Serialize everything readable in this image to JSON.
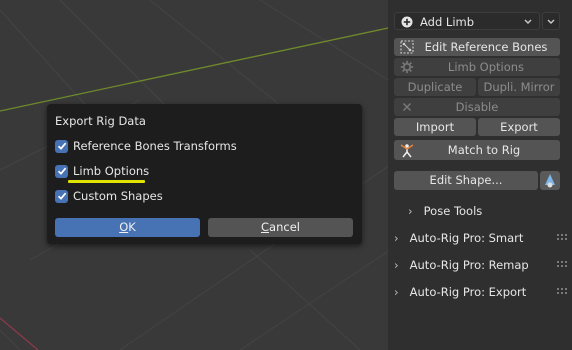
{
  "panel": {
    "add_limb": {
      "label": "Add Limb"
    },
    "edit_reference_bones": "Edit Reference Bones",
    "limb_options": "Limb Options",
    "duplicate": "Duplicate",
    "dupli_mirror": "Dupli. Mirror",
    "disable": "Disable",
    "import": "Import",
    "export": "Export",
    "match_to_rig": "Match to Rig",
    "edit_shape": "Edit Shape...",
    "sections": [
      {
        "label": "Pose Tools"
      },
      {
        "label": "Auto-Rig Pro: Smart"
      },
      {
        "label": "Auto-Rig Pro: Remap"
      },
      {
        "label": "Auto-Rig Pro: Export"
      }
    ]
  },
  "dialog": {
    "title": "Export Rig Data",
    "options": [
      {
        "label": "Reference Bones Transforms",
        "checked": true
      },
      {
        "label": "Limb Options",
        "checked": true
      },
      {
        "label": "Custom Shapes",
        "checked": true
      }
    ],
    "ok": {
      "mnemonic": "O",
      "rest": "K"
    },
    "cancel": {
      "mnemonic": "C",
      "rest": "ancel"
    }
  },
  "colors": {
    "accent": "#4772b3",
    "highlight_underline": "#dfe300",
    "viewport_bg": "#393939",
    "panel_bg": "#2f2f2f",
    "dialog_bg": "#1d1d1d"
  }
}
